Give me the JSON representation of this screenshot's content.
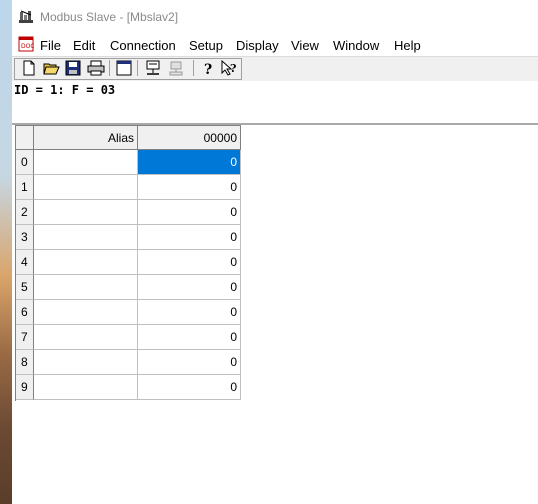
{
  "window": {
    "title": "Modbus Slave - [Mbslav2]"
  },
  "menu": {
    "items": [
      "File",
      "Edit",
      "Connection",
      "Setup",
      "Display",
      "View",
      "Window",
      "Help"
    ]
  },
  "toolbar": {
    "buttons": [
      "new-icon",
      "open-icon",
      "save-icon",
      "print-icon",
      "window-icon",
      "connect-icon",
      "disconnect-icon",
      "help-icon",
      "context-help-icon"
    ]
  },
  "status": {
    "info": "ID = 1: F = 03"
  },
  "table": {
    "columns": [
      "Alias",
      "00000"
    ],
    "rows": [
      {
        "index": "0",
        "alias": "",
        "value": "0",
        "selected": true
      },
      {
        "index": "1",
        "alias": "",
        "value": "0"
      },
      {
        "index": "2",
        "alias": "",
        "value": "0"
      },
      {
        "index": "3",
        "alias": "",
        "value": "0"
      },
      {
        "index": "4",
        "alias": "",
        "value": "0"
      },
      {
        "index": "5",
        "alias": "",
        "value": "0"
      },
      {
        "index": "6",
        "alias": "",
        "value": "0"
      },
      {
        "index": "7",
        "alias": "",
        "value": "0"
      },
      {
        "index": "8",
        "alias": "",
        "value": "0"
      },
      {
        "index": "9",
        "alias": "",
        "value": "0"
      }
    ]
  },
  "colors": {
    "selection": "#0078d7",
    "toolbar_bg": "#f0f0f0",
    "title_text": "#8a8a8a"
  }
}
